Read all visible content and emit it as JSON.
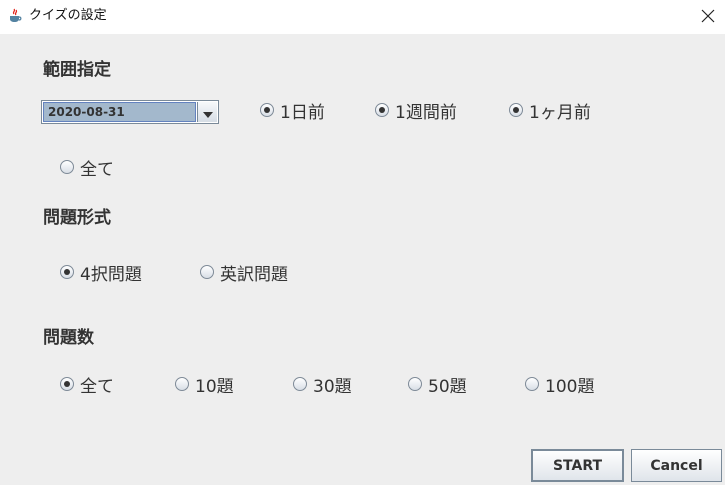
{
  "window": {
    "title": "クイズの設定",
    "close_glyph": "✕"
  },
  "range": {
    "heading": "範囲指定",
    "date_value": "2020-08-31",
    "options": [
      {
        "label": "1日前",
        "checked": true
      },
      {
        "label": "1週間前",
        "checked": true
      },
      {
        "label": "1ヶ月前",
        "checked": true
      },
      {
        "label": "全て",
        "checked": false
      }
    ]
  },
  "format": {
    "heading": "問題形式",
    "options": [
      {
        "label": "4択問題",
        "checked": true
      },
      {
        "label": "英訳問題",
        "checked": false
      }
    ]
  },
  "count": {
    "heading": "問題数",
    "options": [
      {
        "label": "全て",
        "checked": true
      },
      {
        "label": "10題",
        "checked": false
      },
      {
        "label": "30題",
        "checked": false
      },
      {
        "label": "50題",
        "checked": false
      },
      {
        "label": "100題",
        "checked": false
      }
    ]
  },
  "buttons": {
    "start": "START",
    "cancel": "Cancel"
  }
}
